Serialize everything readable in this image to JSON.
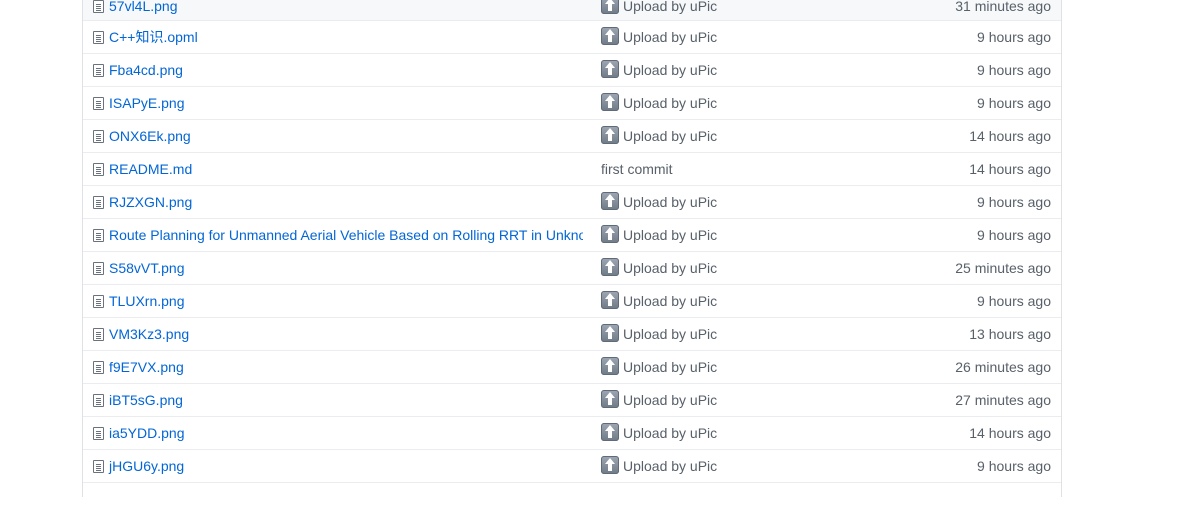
{
  "files": [
    {
      "name": "57vl4L.png",
      "message": "Upload by uPic",
      "age": "31 minutes ago",
      "upload_icon": true
    },
    {
      "name": "C++知识.opml",
      "message": "Upload by uPic",
      "age": "9 hours ago",
      "upload_icon": true
    },
    {
      "name": "Fba4cd.png",
      "message": "Upload by uPic",
      "age": "9 hours ago",
      "upload_icon": true
    },
    {
      "name": "ISAPyE.png",
      "message": "Upload by uPic",
      "age": "9 hours ago",
      "upload_icon": true
    },
    {
      "name": "ONX6Ek.png",
      "message": "Upload by uPic",
      "age": "14 hours ago",
      "upload_icon": true
    },
    {
      "name": "README.md",
      "message": "first commit",
      "age": "14 hours ago",
      "upload_icon": false
    },
    {
      "name": "RJZXGN.png",
      "message": "Upload by uPic",
      "age": "9 hours ago",
      "upload_icon": true
    },
    {
      "name": "Route Planning for Unmanned Aerial Vehicle Based on Rolling RRT in Unkno...",
      "message": "Upload by uPic",
      "age": "9 hours ago",
      "upload_icon": true
    },
    {
      "name": "S58vVT.png",
      "message": "Upload by uPic",
      "age": "25 minutes ago",
      "upload_icon": true
    },
    {
      "name": "TLUXrn.png",
      "message": "Upload by uPic",
      "age": "9 hours ago",
      "upload_icon": true
    },
    {
      "name": "VM3Kz3.png",
      "message": "Upload by uPic",
      "age": "13 hours ago",
      "upload_icon": true
    },
    {
      "name": "f9E7VX.png",
      "message": "Upload by uPic",
      "age": "26 minutes ago",
      "upload_icon": true
    },
    {
      "name": "iBT5sG.png",
      "message": "Upload by uPic",
      "age": "27 minutes ago",
      "upload_icon": true
    },
    {
      "name": "ia5YDD.png",
      "message": "Upload by uPic",
      "age": "14 hours ago",
      "upload_icon": true
    },
    {
      "name": "jHGU6y.png",
      "message": "Upload by uPic",
      "age": "9 hours ago",
      "upload_icon": true
    }
  ],
  "colors": {
    "link": "#0366d6",
    "muted_text": "#586069",
    "border": "#eaecef"
  },
  "icons": {
    "file": "file-icon",
    "upload": "upload-arrow-icon"
  }
}
